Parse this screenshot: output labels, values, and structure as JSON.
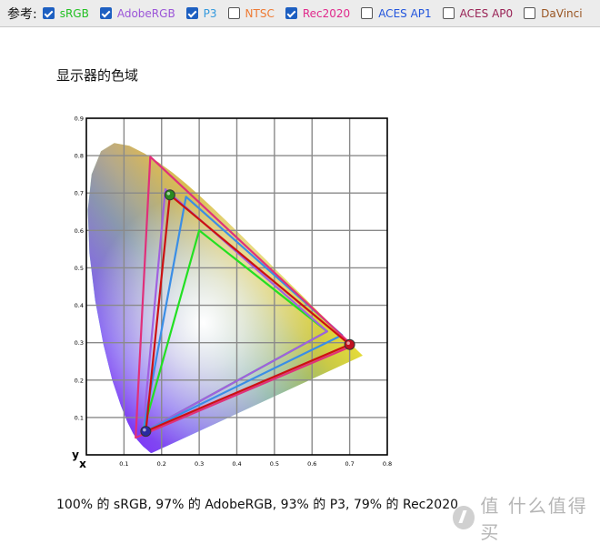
{
  "topbar": {
    "lead_label": "参考:",
    "options": [
      {
        "label": "sRGB",
        "checked": true,
        "color": "#22c022"
      },
      {
        "label": "AdobeRGB",
        "checked": true,
        "color": "#9b55d8"
      },
      {
        "label": "P3",
        "checked": true,
        "color": "#3399dd"
      },
      {
        "label": "NTSC",
        "checked": false,
        "color": "#ee7a33"
      },
      {
        "label": "Rec2020",
        "checked": true,
        "color": "#e02a8c"
      },
      {
        "label": "ACES AP1",
        "checked": false,
        "color": "#2255dd"
      },
      {
        "label": "ACES AP0",
        "checked": false,
        "color": "#992255"
      },
      {
        "label": "DaVinci",
        "checked": false,
        "color": "#995522"
      }
    ]
  },
  "heading": "显示器的色域",
  "caption": "100% 的 sRGB, 97% 的 AdobeRGB, 93% 的 P3, 79% 的 Rec2020",
  "watermark": "值 什么值得买",
  "chart_data": {
    "type": "cie-chromaticity",
    "xlabel": "x",
    "ylabel": "y",
    "xlim": [
      0,
      0.8
    ],
    "ylim": [
      0,
      0.9
    ],
    "x_ticks": [
      "0.1",
      "0.2",
      "0.3",
      "0.4",
      "0.5",
      "0.6",
      "0.7",
      "0.8"
    ],
    "y_ticks": [
      "0.1",
      "0.2",
      "0.3",
      "0.4",
      "0.5",
      "0.6",
      "0.7",
      "0.8",
      "0.9"
    ],
    "grid": true,
    "gamuts": [
      {
        "name": "sRGB",
        "color": "#22e022",
        "points": [
          [
            0.64,
            0.33
          ],
          [
            0.3,
            0.6
          ],
          [
            0.15,
            0.06
          ]
        ]
      },
      {
        "name": "AdobeRGB",
        "color": "#a060e0",
        "points": [
          [
            0.64,
            0.33
          ],
          [
            0.21,
            0.71
          ],
          [
            0.15,
            0.06
          ]
        ]
      },
      {
        "name": "P3",
        "color": "#3a8ee6",
        "points": [
          [
            0.68,
            0.32
          ],
          [
            0.265,
            0.69
          ],
          [
            0.15,
            0.06
          ]
        ]
      },
      {
        "name": "Rec2020",
        "color": "#e0307a",
        "points": [
          [
            0.708,
            0.292
          ],
          [
            0.17,
            0.797
          ],
          [
            0.131,
            0.046
          ]
        ]
      },
      {
        "name": "monitor",
        "color": "#cc1111",
        "points": [
          [
            0.7,
            0.295
          ],
          [
            0.222,
            0.695
          ],
          [
            0.158,
            0.063
          ]
        ]
      }
    ],
    "primaries_marked": [
      [
        0.7,
        0.295
      ],
      [
        0.222,
        0.695
      ],
      [
        0.158,
        0.063
      ]
    ]
  }
}
